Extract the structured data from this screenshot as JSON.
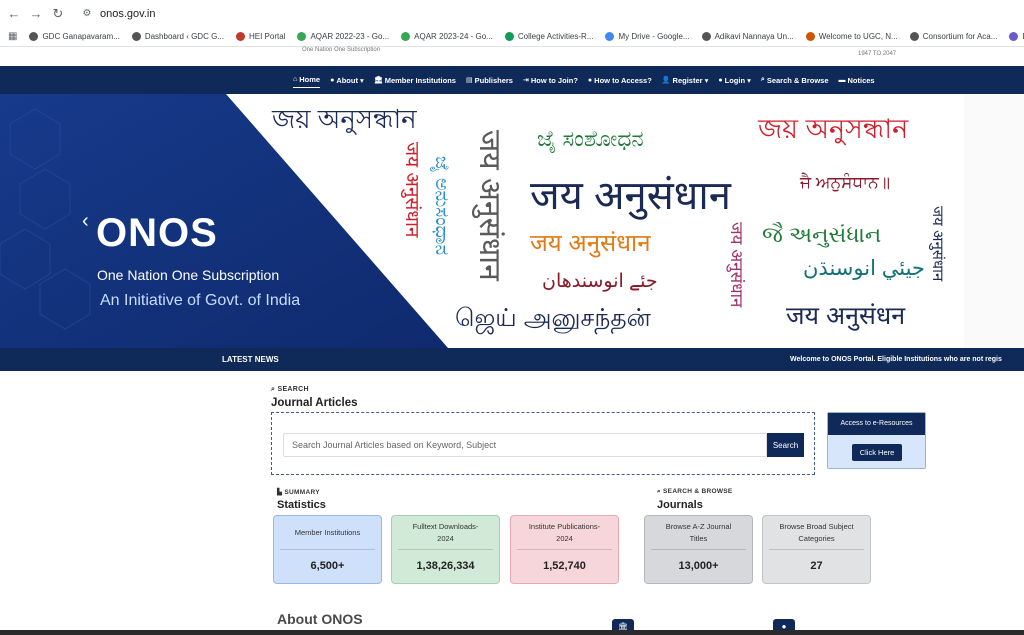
{
  "browser": {
    "url": "onos.gov.in",
    "bookmarks": [
      {
        "label": "GDC Ganapavaram...",
        "color": "#555"
      },
      {
        "label": "Dashboard ‹ GDC G...",
        "color": "#555"
      },
      {
        "label": "HEI Portal",
        "color": "#c0392b"
      },
      {
        "label": "AQAR 2022-23 - Go...",
        "color": "#34a853"
      },
      {
        "label": "AQAR 2023-24 - Go...",
        "color": "#34a853"
      },
      {
        "label": "College Activities-R...",
        "color": "#0f9d58"
      },
      {
        "label": "My Drive - Google...",
        "color": "#4285f4"
      },
      {
        "label": "Adikavi Nannaya Un...",
        "color": "#555"
      },
      {
        "label": "Welcome to UGC, N...",
        "color": "#d35400"
      },
      {
        "label": "Consortium for Aca...",
        "color": "#555"
      },
      {
        "label": "DUJES",
        "color": "#6a5acd"
      }
    ]
  },
  "site": {
    "tagline": "One Nation One Subscription",
    "years": "1947 TO 2047"
  },
  "nav": {
    "items": [
      {
        "label": "Home",
        "icon": "⌂"
      },
      {
        "label": "About ▾",
        "icon": "●"
      },
      {
        "label": "Member Institutions",
        "icon": "🏛"
      },
      {
        "label": "Publishers",
        "icon": "▤"
      },
      {
        "label": "How to Join?",
        "icon": "⇥"
      },
      {
        "label": "How to Access?",
        "icon": "●"
      },
      {
        "label": "Register ▾",
        "icon": "👤"
      },
      {
        "label": "Login ▾",
        "icon": "●"
      },
      {
        "label": "Search & Browse",
        "icon": "⌕"
      },
      {
        "label": "Notices",
        "icon": "▬"
      }
    ]
  },
  "hero": {
    "title": "ONOS",
    "subtitle": "One Nation One Subscription",
    "initiative": "An Initiative of Govt. of India",
    "words": [
      {
        "text": "জয় অনুসন্ধান",
        "color": "#1b2a55"
      },
      {
        "text": "ಜೈ ಸಂಶೋಧನ",
        "color": "#1f7a3a"
      },
      {
        "text": "জয় অনুসন্ধান",
        "color": "#d01e2a"
      },
      {
        "text": "जय अनुसंधान",
        "color": "#1b2a55"
      },
      {
        "text": "ਜੈ ਅਨੁਸੰਧਾਨ॥",
        "color": "#8a1a2a"
      },
      {
        "text": "जय अनुसंधान",
        "color": "#e07b16"
      },
      {
        "text": "જૈ અનુસંધાન",
        "color": "#1f7a3a"
      },
      {
        "text": "جئے انوسندھان",
        "color": "#8a1a2a"
      },
      {
        "text": "جيئي انوسنڌن",
        "color": "#12707a"
      },
      {
        "text": "ஜெய் அனுசந்தன்",
        "color": "#1b2a55"
      },
      {
        "text": "जय अनुसंधन",
        "color": "#1b2a55"
      }
    ]
  },
  "news": {
    "label": "LATEST NEWS",
    "ticker": "Welcome to ONOS Portal. Eligible Institutions who are not regis"
  },
  "search": {
    "kicker": "SEARCH",
    "title": "Journal Articles",
    "placeholder": "Search Journal Articles based on Keyword, Subject",
    "button": "Search",
    "access_title": "Access to e-Resources",
    "access_button": "Click Here"
  },
  "statistics": {
    "kicker": "SUMMARY",
    "title": "Statistics",
    "cards": [
      {
        "label": "Member Institutions",
        "value": "6,500+"
      },
      {
        "label": "Fulltext Downloads-2024",
        "value": "1,38,26,334"
      },
      {
        "label": "Institute Publications-2024",
        "value": "1,52,740"
      }
    ]
  },
  "journals": {
    "kicker": "SEARCH & BROWSE",
    "title": "Journals",
    "cards": [
      {
        "label": "Browse A-Z Journal Titles",
        "value": "13,000+"
      },
      {
        "label": "Browse Broad Subject Categories",
        "value": "27"
      }
    ]
  },
  "about": {
    "title": "About ONOS"
  }
}
